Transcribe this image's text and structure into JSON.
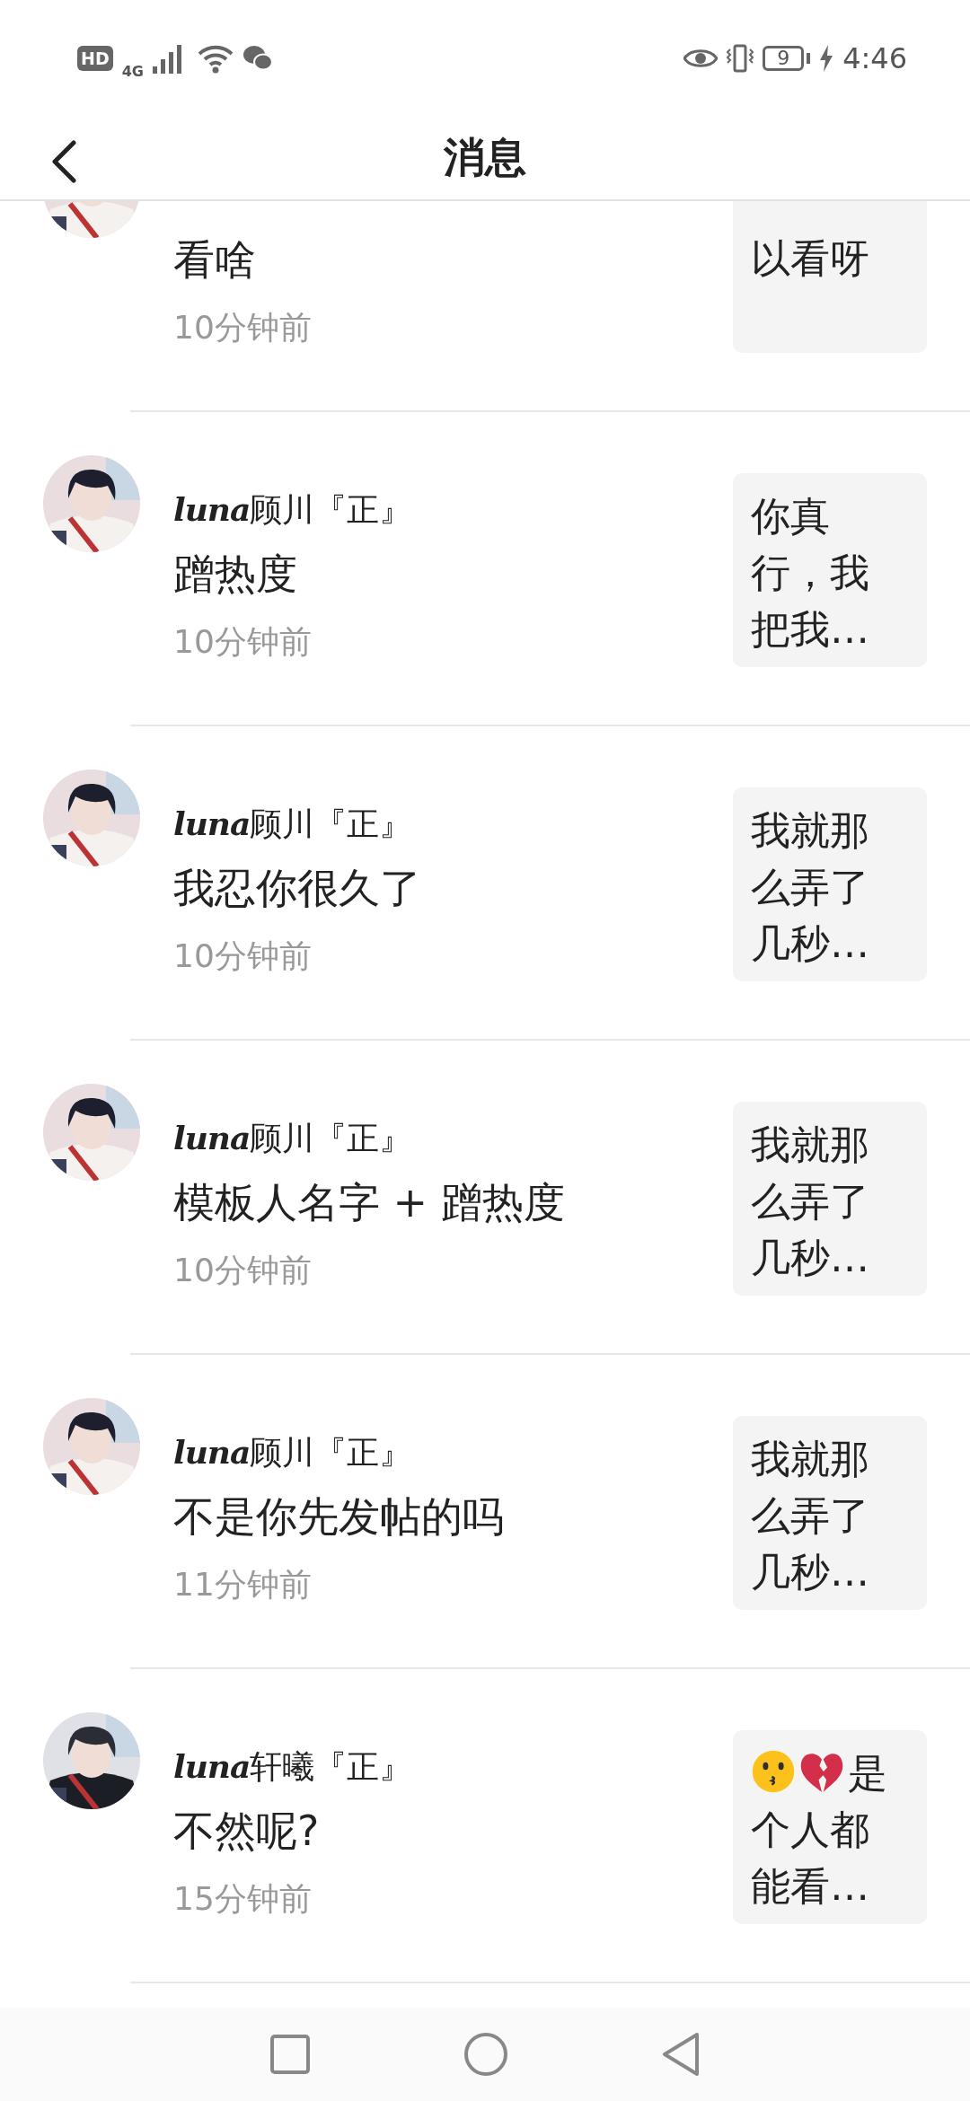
{
  "status_bar": {
    "hd": "HD",
    "network": "4G",
    "battery": "9",
    "time": "4:46"
  },
  "header": {
    "title": "消息"
  },
  "messages": [
    {
      "cut": true,
      "text": "看啥",
      "time": "10分钟前",
      "preview": "以看呀"
    },
    {
      "cut": false,
      "name_prefix": "luna",
      "name": "顾川『正』",
      "text": "蹭热度",
      "time": "10分钟前",
      "preview": "你真行，我把我…"
    },
    {
      "cut": false,
      "name_prefix": "luna",
      "name": "顾川『正』",
      "text": "我忍你很久了",
      "time": "10分钟前",
      "preview": "我就那么弄了几秒…"
    },
    {
      "cut": false,
      "name_prefix": "luna",
      "name": "顾川『正』",
      "text": "模板人名字 + 蹭热度",
      "time": "10分钟前",
      "preview": "我就那么弄了几秒…"
    },
    {
      "cut": false,
      "name_prefix": "luna",
      "name": "顾川『正』",
      "text": "不是你先发帖的吗",
      "time": "11分钟前",
      "preview": "我就那么弄了几秒…"
    },
    {
      "cut": false,
      "name_prefix": "luna",
      "name": "轩曦『正』",
      "text": "不然呢?",
      "time": "15分钟前",
      "preview": "是个人都能看…",
      "preview_emoji": true
    }
  ]
}
